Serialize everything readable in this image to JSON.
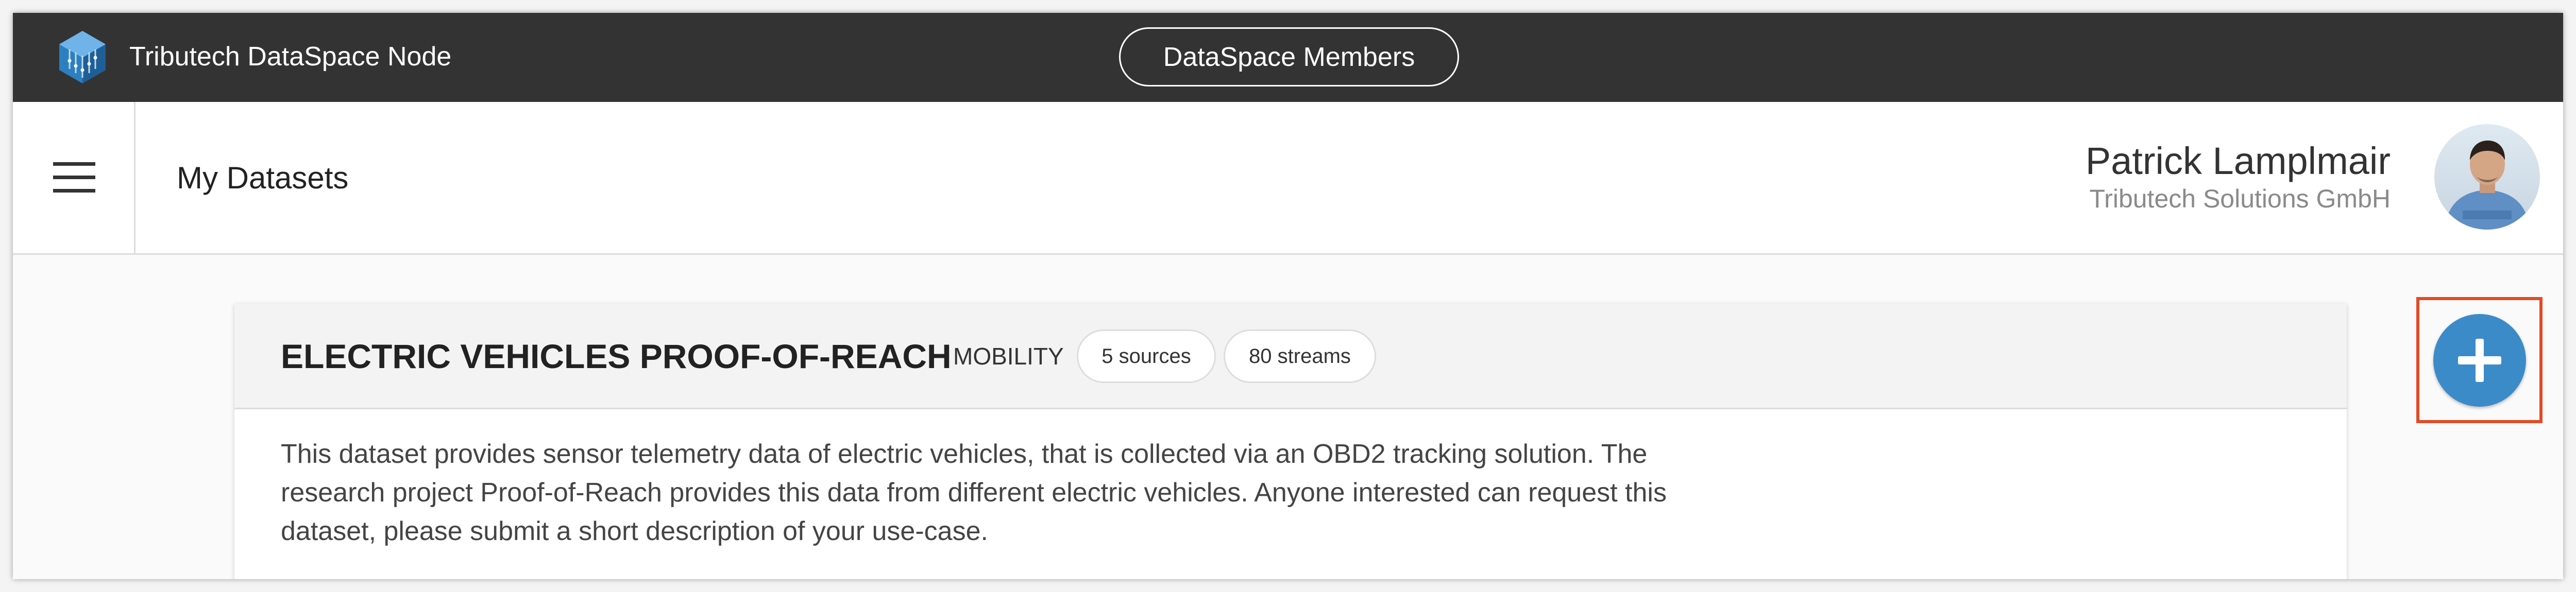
{
  "topbar": {
    "app_title": "Tributech DataSpace Node",
    "members_button": "DataSpace Members",
    "colors": {
      "background": "#333333",
      "text": "#ffffff"
    }
  },
  "header": {
    "menu_icon": "hamburger-menu-icon",
    "page_title": "My Datasets",
    "user": {
      "name": "Patrick Lamplmair",
      "organization": "Tributech Solutions GmbH",
      "avatar_icon": "user-avatar"
    }
  },
  "datasets": [
    {
      "title": "ELECTRIC VEHICLES PROOF-OF-REACH",
      "category": "MOBILITY",
      "sources": "5 sources",
      "streams": "80 streams",
      "description": "This dataset provides sensor telemetry data of electric vehicles, that is collected via an OBD2 tracking solution. The research project Proof-of-Reach provides this data from different electric vehicles. Anyone interested can request this dataset, please submit a short description of your use-case."
    }
  ],
  "actions": {
    "add_icon": "plus-icon",
    "add_color": "#3b8bc9",
    "highlight_color": "#e34a24"
  }
}
